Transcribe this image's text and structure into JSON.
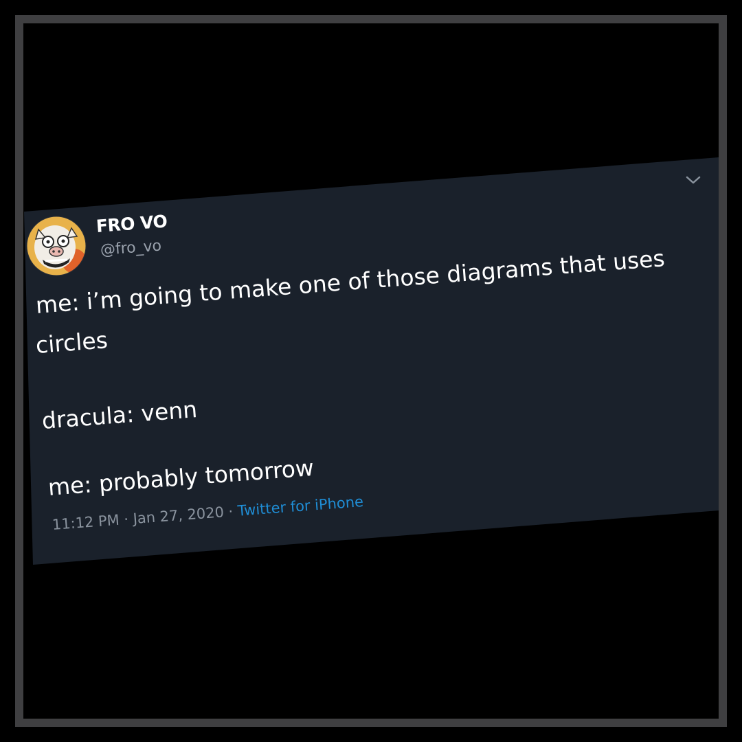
{
  "tweet": {
    "author_name": "FRO VO",
    "author_handle": "@fro_vo",
    "lines": [
      "me: i’m going to make one of those diagrams that uses",
      "circles",
      "dracula: venn",
      "me: probably tomorrow"
    ],
    "time": "11:12 PM",
    "separator": " · ",
    "date": "Jan 27, 2020",
    "source": "Twitter for iPhone"
  },
  "icons": {
    "chevron": "chevron-down-icon",
    "avatar": "cartoon-pig-avatar"
  },
  "colors": {
    "card": "#1a212b",
    "frame": "#3f3f41",
    "text": "#ffffff",
    "muted": "#8a939e",
    "link": "#1f8ed6"
  }
}
